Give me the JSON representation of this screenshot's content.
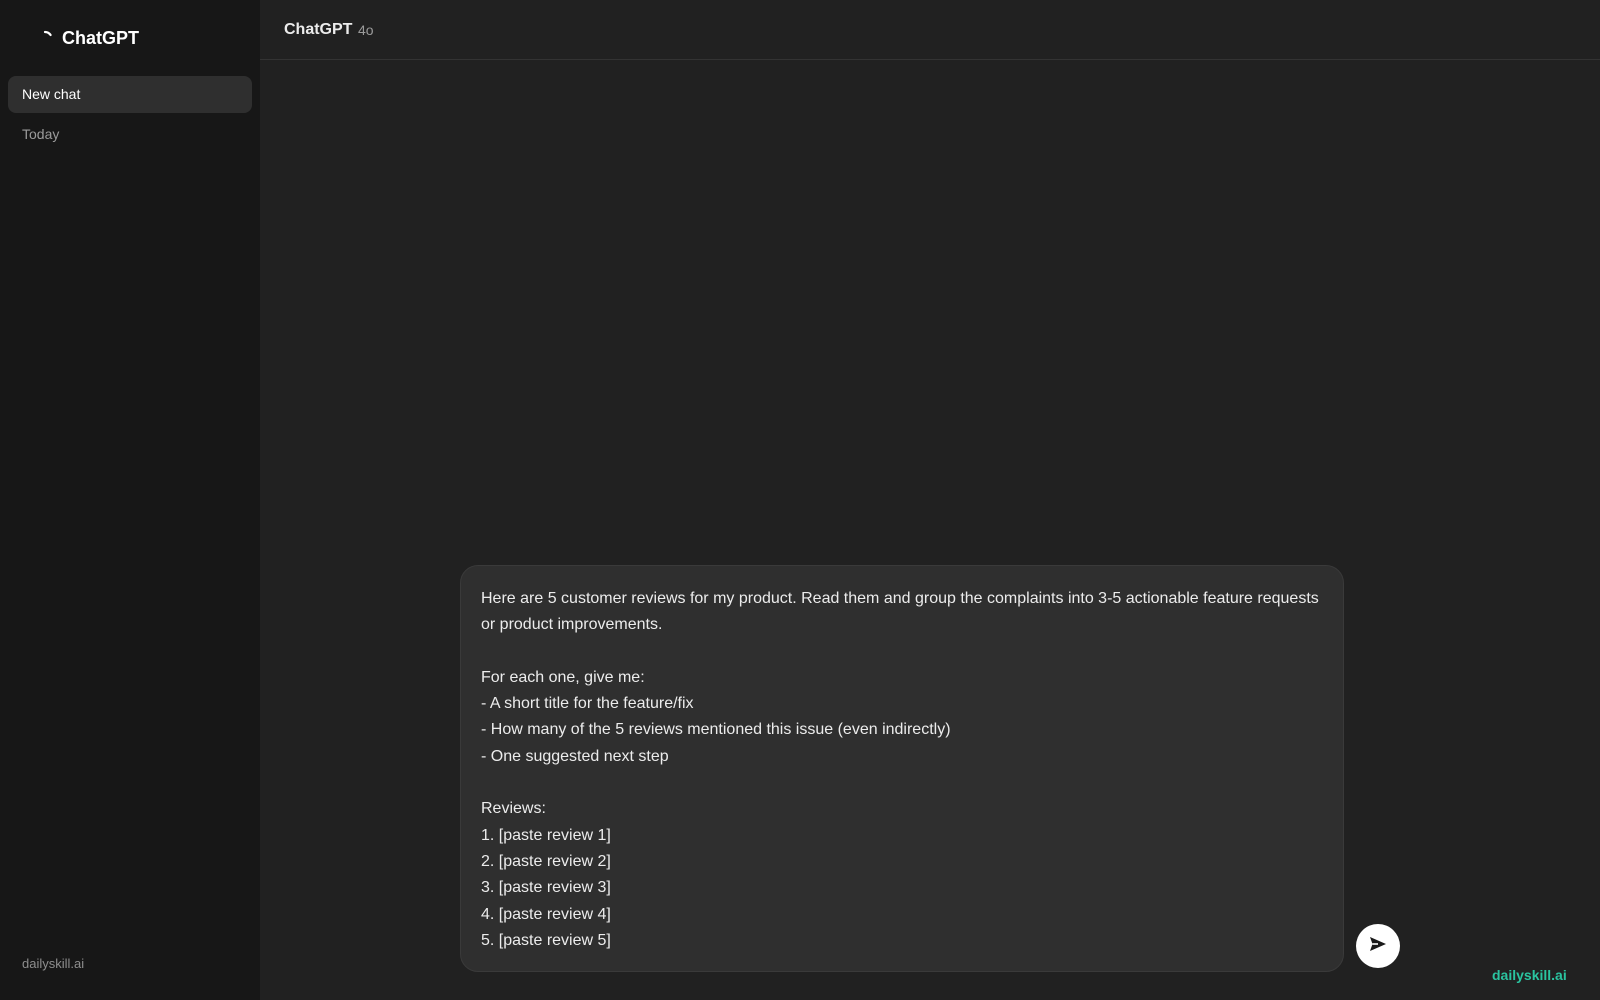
{
  "sidebar": {
    "brand": "ChatGPT",
    "brand_icon": "loading-spinner-icon",
    "new_chat_label": "New chat",
    "section_label": "Today",
    "footer": "dailyskill.ai"
  },
  "header": {
    "title": "ChatGPT",
    "model": "4o"
  },
  "composer": {
    "text": "Here are 5 customer reviews for my product. Read them and group the complaints into 3-5 actionable feature requests or product improvements.\n\nFor each one, give me:\n- A short title for the feature/fix\n- How many of the 5 reviews mentioned this issue (even indirectly)\n- One suggested next step\n\nReviews:\n1. [paste review 1]\n2. [paste review 2]\n3. [paste review 3]\n4. [paste review 4]\n5. [paste review 5]",
    "send_icon": "send-arrow-icon"
  },
  "watermark": "dailyskill.ai",
  "colors": {
    "background": "#212121",
    "sidebar": "#171717",
    "composer": "#2f2f2f",
    "accent": "#2ac4a0"
  }
}
